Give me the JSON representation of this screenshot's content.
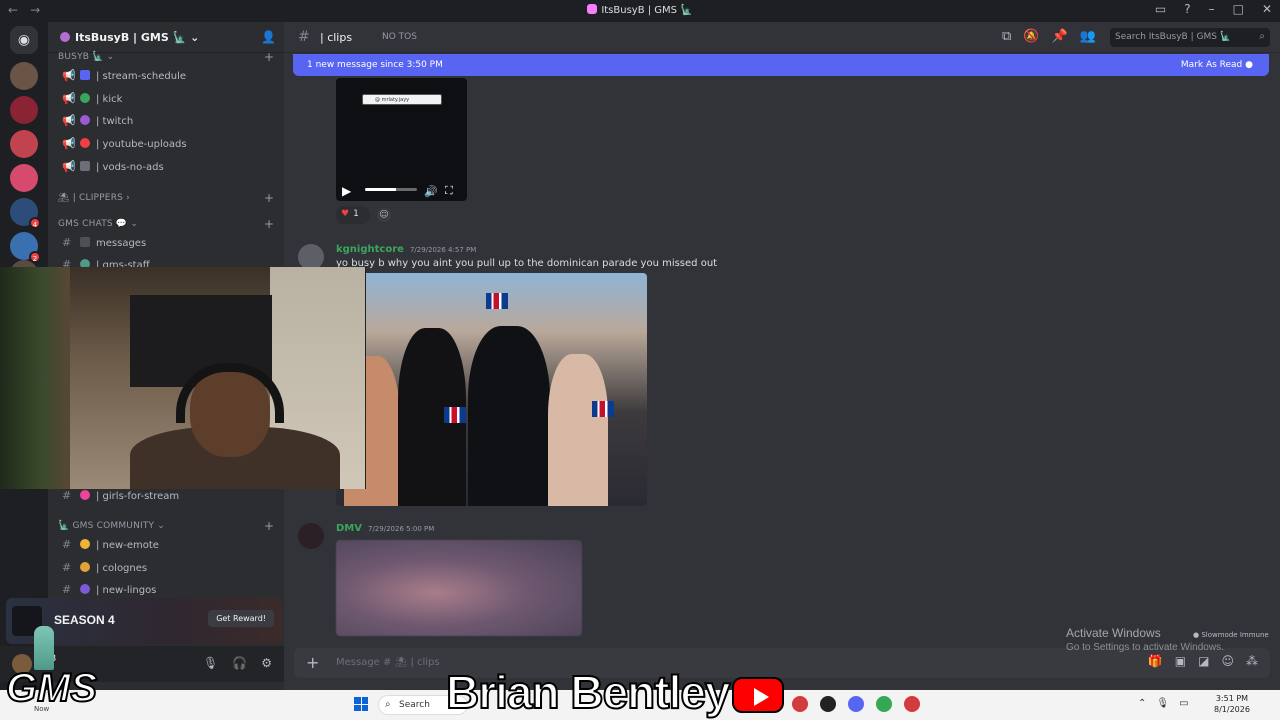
{
  "window": {
    "title": "ItsBusyB | GMS 🗽",
    "back": "←",
    "forward": "→"
  },
  "servers": [
    {
      "name": "home",
      "badge": ""
    },
    {
      "name": "server-1",
      "badge": ""
    },
    {
      "name": "server-2",
      "badge": ""
    },
    {
      "name": "server-3",
      "badge": ""
    },
    {
      "name": "server-4",
      "badge": ""
    },
    {
      "name": "server-5",
      "badge": "4"
    },
    {
      "name": "server-6",
      "badge": "2"
    },
    {
      "name": "server-7",
      "badge": ""
    }
  ],
  "sidebar": {
    "server_name": "ItsBusyB | GMS 🗽",
    "categories": {
      "busyb": "BUSYB 🗽",
      "clippers": "| CLIPPERS",
      "gms_chats": "GMS CHATS 💬",
      "community": "GMS COMMUNITY"
    },
    "channels": {
      "stream_schedule": "| stream-schedule",
      "kick": "| kick",
      "twitch": "| twitch",
      "youtube_uploads": "| youtube-uploads",
      "vods_no_ads": "| vods-no-ads",
      "messages": "messages",
      "gms_staff": "| gms-staff",
      "girls_for_stream": "| girls-for-stream",
      "new_emote": "| new-emote",
      "colognes": "| colognes",
      "new_lingos": "| new-lingos"
    }
  },
  "promo": {
    "title": "SEASON 4",
    "button": "Get Reward!"
  },
  "userbar": {
    "name": "B"
  },
  "channel": {
    "name": "| clips",
    "topic": "NO TOS",
    "search_placeholder": "Search ItsBusyB | GMS 🗽"
  },
  "new_messages": {
    "text": "1 new message since 3:50 PM",
    "action": "Mark As Read"
  },
  "video": {
    "tiktok_handle": "@ mrlaty.jayy"
  },
  "reaction": {
    "count": "1"
  },
  "messages": [
    {
      "author": "kgnightcore",
      "time": "7/29/2026 4:57 PM",
      "text": "yo busy b why you aint you pull up to the dominican parade you missed out",
      "author_color": "#3ba55d"
    },
    {
      "author": "DMV",
      "time": "7/29/2026 5:00 PM",
      "text": "",
      "author_color": "#3ba55d"
    }
  ],
  "composer": {
    "placeholder": "Message # ⛱ | clips"
  },
  "watermark": {
    "title": "Activate Windows",
    "subtitle": "Go to Settings to activate Windows."
  },
  "slowmode": "Slowmode Immune",
  "taskbar": {
    "search": "Search",
    "time": "3:51 PM",
    "date": "8/1/2026",
    "now": "Now"
  },
  "overlay": {
    "gms": "GMS",
    "brand": "Brian Bentley"
  }
}
